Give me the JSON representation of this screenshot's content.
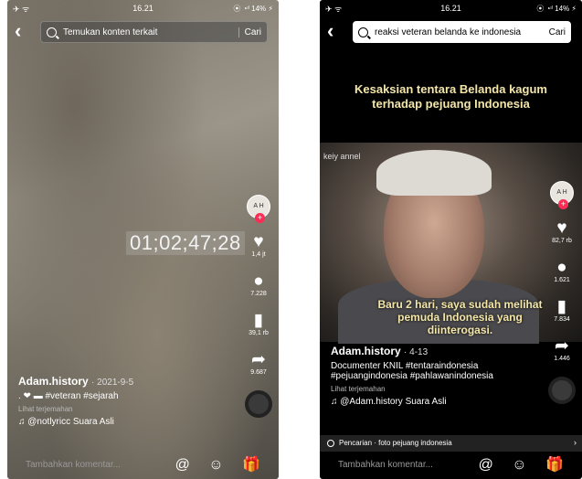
{
  "left": {
    "status": {
      "left": "✈ ᯤ",
      "time": "16.21",
      "right": "⦿ ◔ᶦˡ 14% ⚡"
    },
    "search": {
      "back": "‹",
      "query": "Temukan konten terkait",
      "button": "Cari"
    },
    "timestamp_overlay": "01;02;47;28",
    "rail": {
      "avatar": "A H",
      "plus": "+",
      "likes": "1,4 jt",
      "comments": "7.228",
      "saves": "39,1 rb",
      "shares": "9.687"
    },
    "post": {
      "username": "Adam.history",
      "date": "· 2021-9-5",
      "caption": ". ❤ ▬ #veteran #sejarah",
      "translate": "Lihat terjemahan",
      "sound": "♫ @notlyricc Suara Asli"
    },
    "comment": {
      "placeholder": "Tambahkan komentar...",
      "icons": "@ ☺ 🎁"
    }
  },
  "right": {
    "status": {
      "left": "✈ ᯤ",
      "time": "16.21",
      "right": "⦿ ◔ᶦˡ 14% ⚡"
    },
    "search": {
      "back": "‹",
      "query": "reaksi veteran belanda ke indonesia",
      "button": "Cari"
    },
    "headline": "Kesaksian tentara Belanda kagum terhadap pejuang Indonesia",
    "video_watermark": "keiy annel",
    "subtitle": "Baru 2 hari, saya sudah melihat pemuda Indonesia yang diinterogasi.",
    "rail": {
      "avatar": "A H",
      "plus": "+",
      "likes": "82,7 rb",
      "comments": "1.621",
      "saves": "7.834",
      "shares": "1.446"
    },
    "post": {
      "username": "Adam.history",
      "date": "· 4-13",
      "caption": "Documenter KNIL #tentaraindonesia #pejuangindonesia #pahlawanindonesia",
      "translate": "Lihat terjemahan",
      "sound": "♫ @Adam.history Suara Asli"
    },
    "related_search": {
      "text": "Pencarian · foto pejuang indonesia",
      "close": "›"
    },
    "comment": {
      "placeholder": "Tambahkan komentar...",
      "icons": "@ ☺ 🎁"
    }
  },
  "colors": {
    "accent": "#fe2c55",
    "headline": "#f3e6a8"
  }
}
